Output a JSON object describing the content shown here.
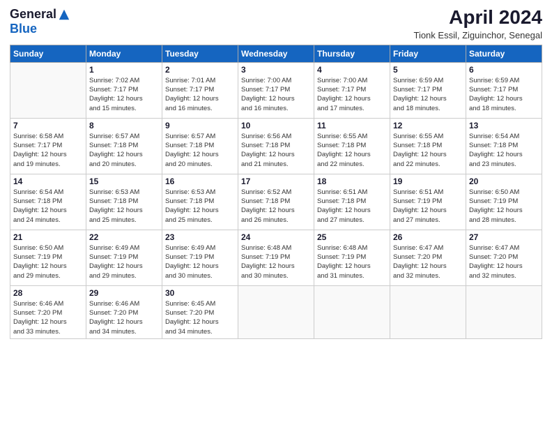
{
  "header": {
    "logo_general": "General",
    "logo_blue": "Blue",
    "title": "April 2024",
    "subtitle": "Tionk Essil, Ziguinchor, Senegal"
  },
  "days_of_week": [
    "Sunday",
    "Monday",
    "Tuesday",
    "Wednesday",
    "Thursday",
    "Friday",
    "Saturday"
  ],
  "weeks": [
    [
      {
        "num": "",
        "info": ""
      },
      {
        "num": "1",
        "info": "Sunrise: 7:02 AM\nSunset: 7:17 PM\nDaylight: 12 hours\nand 15 minutes."
      },
      {
        "num": "2",
        "info": "Sunrise: 7:01 AM\nSunset: 7:17 PM\nDaylight: 12 hours\nand 16 minutes."
      },
      {
        "num": "3",
        "info": "Sunrise: 7:00 AM\nSunset: 7:17 PM\nDaylight: 12 hours\nand 16 minutes."
      },
      {
        "num": "4",
        "info": "Sunrise: 7:00 AM\nSunset: 7:17 PM\nDaylight: 12 hours\nand 17 minutes."
      },
      {
        "num": "5",
        "info": "Sunrise: 6:59 AM\nSunset: 7:17 PM\nDaylight: 12 hours\nand 18 minutes."
      },
      {
        "num": "6",
        "info": "Sunrise: 6:59 AM\nSunset: 7:17 PM\nDaylight: 12 hours\nand 18 minutes."
      }
    ],
    [
      {
        "num": "7",
        "info": "Sunrise: 6:58 AM\nSunset: 7:17 PM\nDaylight: 12 hours\nand 19 minutes."
      },
      {
        "num": "8",
        "info": "Sunrise: 6:57 AM\nSunset: 7:18 PM\nDaylight: 12 hours\nand 20 minutes."
      },
      {
        "num": "9",
        "info": "Sunrise: 6:57 AM\nSunset: 7:18 PM\nDaylight: 12 hours\nand 20 minutes."
      },
      {
        "num": "10",
        "info": "Sunrise: 6:56 AM\nSunset: 7:18 PM\nDaylight: 12 hours\nand 21 minutes."
      },
      {
        "num": "11",
        "info": "Sunrise: 6:55 AM\nSunset: 7:18 PM\nDaylight: 12 hours\nand 22 minutes."
      },
      {
        "num": "12",
        "info": "Sunrise: 6:55 AM\nSunset: 7:18 PM\nDaylight: 12 hours\nand 22 minutes."
      },
      {
        "num": "13",
        "info": "Sunrise: 6:54 AM\nSunset: 7:18 PM\nDaylight: 12 hours\nand 23 minutes."
      }
    ],
    [
      {
        "num": "14",
        "info": "Sunrise: 6:54 AM\nSunset: 7:18 PM\nDaylight: 12 hours\nand 24 minutes."
      },
      {
        "num": "15",
        "info": "Sunrise: 6:53 AM\nSunset: 7:18 PM\nDaylight: 12 hours\nand 25 minutes."
      },
      {
        "num": "16",
        "info": "Sunrise: 6:53 AM\nSunset: 7:18 PM\nDaylight: 12 hours\nand 25 minutes."
      },
      {
        "num": "17",
        "info": "Sunrise: 6:52 AM\nSunset: 7:18 PM\nDaylight: 12 hours\nand 26 minutes."
      },
      {
        "num": "18",
        "info": "Sunrise: 6:51 AM\nSunset: 7:18 PM\nDaylight: 12 hours\nand 27 minutes."
      },
      {
        "num": "19",
        "info": "Sunrise: 6:51 AM\nSunset: 7:19 PM\nDaylight: 12 hours\nand 27 minutes."
      },
      {
        "num": "20",
        "info": "Sunrise: 6:50 AM\nSunset: 7:19 PM\nDaylight: 12 hours\nand 28 minutes."
      }
    ],
    [
      {
        "num": "21",
        "info": "Sunrise: 6:50 AM\nSunset: 7:19 PM\nDaylight: 12 hours\nand 29 minutes."
      },
      {
        "num": "22",
        "info": "Sunrise: 6:49 AM\nSunset: 7:19 PM\nDaylight: 12 hours\nand 29 minutes."
      },
      {
        "num": "23",
        "info": "Sunrise: 6:49 AM\nSunset: 7:19 PM\nDaylight: 12 hours\nand 30 minutes."
      },
      {
        "num": "24",
        "info": "Sunrise: 6:48 AM\nSunset: 7:19 PM\nDaylight: 12 hours\nand 30 minutes."
      },
      {
        "num": "25",
        "info": "Sunrise: 6:48 AM\nSunset: 7:19 PM\nDaylight: 12 hours\nand 31 minutes."
      },
      {
        "num": "26",
        "info": "Sunrise: 6:47 AM\nSunset: 7:20 PM\nDaylight: 12 hours\nand 32 minutes."
      },
      {
        "num": "27",
        "info": "Sunrise: 6:47 AM\nSunset: 7:20 PM\nDaylight: 12 hours\nand 32 minutes."
      }
    ],
    [
      {
        "num": "28",
        "info": "Sunrise: 6:46 AM\nSunset: 7:20 PM\nDaylight: 12 hours\nand 33 minutes."
      },
      {
        "num": "29",
        "info": "Sunrise: 6:46 AM\nSunset: 7:20 PM\nDaylight: 12 hours\nand 34 minutes."
      },
      {
        "num": "30",
        "info": "Sunrise: 6:45 AM\nSunset: 7:20 PM\nDaylight: 12 hours\nand 34 minutes."
      },
      {
        "num": "",
        "info": ""
      },
      {
        "num": "",
        "info": ""
      },
      {
        "num": "",
        "info": ""
      },
      {
        "num": "",
        "info": ""
      }
    ]
  ]
}
